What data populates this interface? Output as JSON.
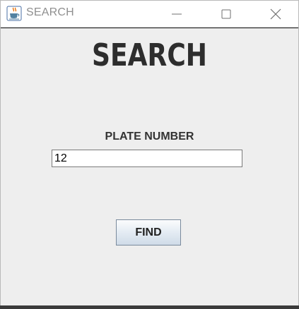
{
  "window": {
    "title": "SEARCH",
    "app_icon": "java-cup-icon",
    "controls": {
      "minimize_icon": "minimize-icon",
      "maximize_icon": "maximize-icon",
      "close_icon": "close-icon"
    }
  },
  "main": {
    "heading": "SEARCH",
    "field_label": "PLATE NUMBER",
    "plate_number_value": "12",
    "find_button_label": "FIND"
  }
}
